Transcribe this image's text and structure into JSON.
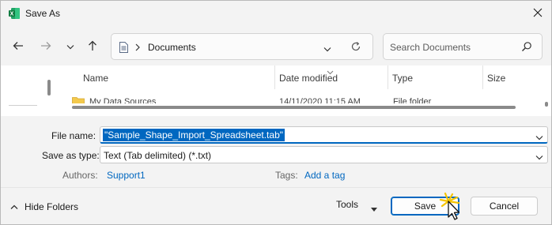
{
  "window": {
    "title": "Save As",
    "app_icon": "excel-icon",
    "brand_color": "#1d6f42",
    "accent_color": "#0067c0"
  },
  "nav": {
    "back_icon": "arrow-left-icon",
    "forward_icon": "arrow-right-icon",
    "recent_icon": "chevron-down-icon",
    "up_icon": "arrow-up-icon",
    "path": "Documents",
    "refresh_icon": "refresh-icon",
    "search_placeholder": "Search Documents",
    "search_icon": "search-icon"
  },
  "columns": [
    {
      "label": "Name"
    },
    {
      "label": "Date modified"
    },
    {
      "label": "Type"
    },
    {
      "label": "Size"
    }
  ],
  "rows": [
    {
      "name": "My Data Sources",
      "date": "14/11/2020 11:15 AM",
      "type": "File folder"
    }
  ],
  "form": {
    "filename_label": "File name:",
    "filename_value": "\"Sample_Shape_Import_Spreadsheet.tab\"",
    "savetype_label": "Save as type:",
    "savetype_value": "Text (Tab delimited) (*.txt)",
    "authors_label": "Authors:",
    "authors_value": "Support1",
    "tags_label": "Tags:",
    "tags_value": "Add a tag"
  },
  "footer": {
    "hide_folders": "Hide Folders",
    "tools": "Tools",
    "save": "Save",
    "cancel": "Cancel"
  }
}
